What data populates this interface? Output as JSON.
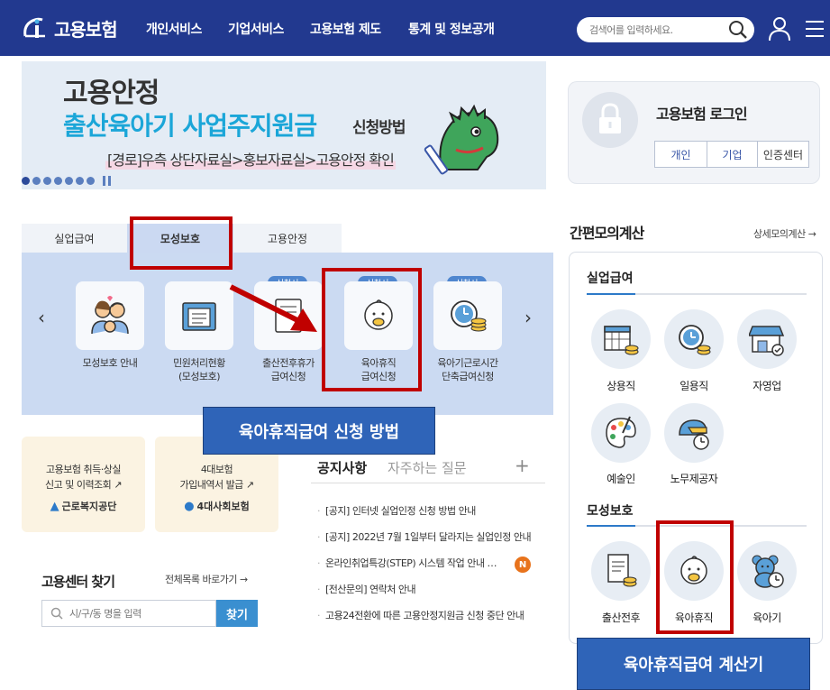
{
  "header": {
    "logo_text": "고용보험",
    "nav": [
      "개인서비스",
      "기업서비스",
      "고용보험 제도",
      "통계 및 정보공개"
    ],
    "search_placeholder": "검색어를 입력하세요."
  },
  "banner": {
    "title1": "고용안정",
    "title2": "출산육아기 사업주지원금",
    "title2_suffix": "신청방법",
    "path": "[경로]우측 상단자료실>홍보자료실>고용안정 확인"
  },
  "login": {
    "title": "고용보험 로그인",
    "buttons": [
      "개인",
      "기업",
      "인증센터"
    ]
  },
  "tabs": [
    "실업급여",
    "모성보호",
    "고용안정"
  ],
  "services": [
    {
      "label": "모성보호 안내",
      "badge": ""
    },
    {
      "label": "민원처리현황\n(모성보호)",
      "badge": ""
    },
    {
      "label": "출산전후휴가\n급여신청",
      "badge": "신청서"
    },
    {
      "label": "육아휴직\n급여신청",
      "badge": "신청서"
    },
    {
      "label": "육아기근로시간\n단축급여신청",
      "badge": "신청서"
    }
  ],
  "mini_cards": [
    {
      "text1": "고용보험 취득·상실",
      "text2": "신고 및 이력조회",
      "logo": "근로복지공단"
    },
    {
      "text1": "4대보험",
      "text2": "가입내역서 발급",
      "logo": "4대사회보험"
    }
  ],
  "center": {
    "title": "고용센터 찾기",
    "link": "전체목록 바로가기",
    "placeholder": "시/구/동 명을 입력",
    "button": "찾기"
  },
  "notice": {
    "tab_active": "공지사항",
    "tab_inactive": "자주하는 질문",
    "plus": "+",
    "new_badge": "N",
    "items": [
      "[공지] 인터넷 실업인정 신청 방법 안내",
      "[공지] 2022년 7월 1일부터 달라지는 실업인정 안내",
      "온라인취업특강(STEP) 시스템 작업 안내 …",
      "[전산문의] 연락처 안내",
      "고용24전환에 따른 고용안정지원금 신청 중단 안내"
    ]
  },
  "calculator": {
    "title": "간편모의계산",
    "link": "상세모의계산",
    "section1": "실업급여",
    "section1_items": [
      "상용직",
      "일용직",
      "자영업",
      "예술인",
      "노무제공자"
    ],
    "section2": "모성보호",
    "section2_items": [
      "출산전후",
      "육아휴직",
      "육아기"
    ]
  },
  "annotations": {
    "callout1": "육아휴직급여 신청 방법",
    "callout2": "육아휴직급여 계산기"
  },
  "colors": {
    "header_bg": "#22398f",
    "panel_bg": "#cbdaf2",
    "badge_bg": "#4f86cf",
    "annotation_red": "#c00000",
    "callout_bg": "#2f64b8"
  }
}
